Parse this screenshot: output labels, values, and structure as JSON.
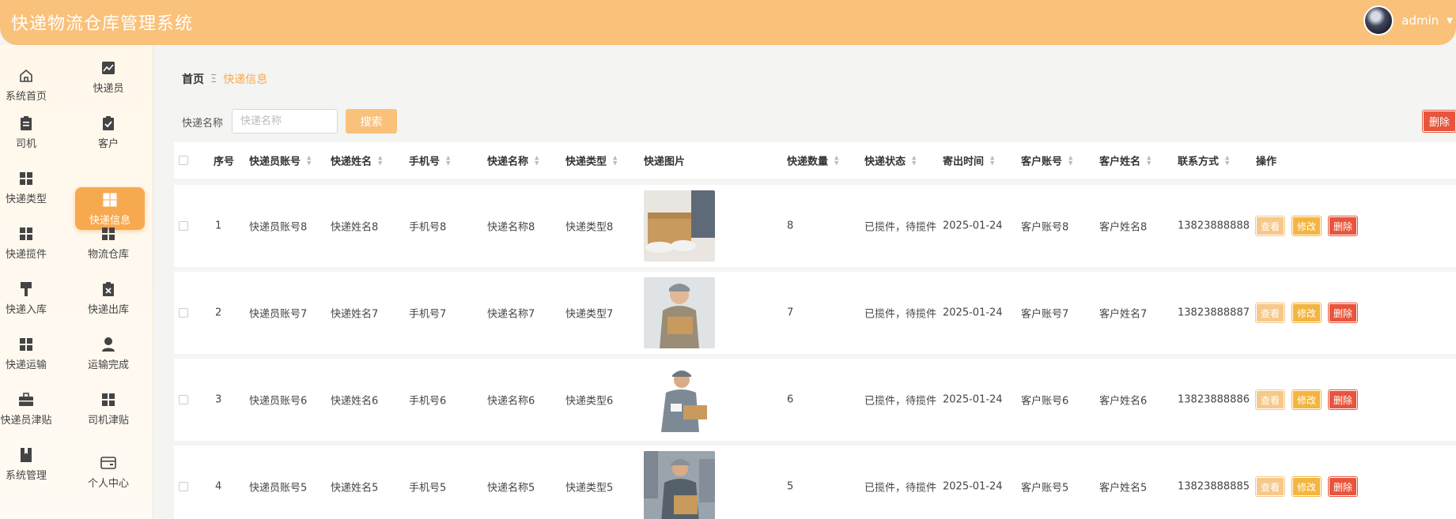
{
  "app": {
    "title": "快递物流仓库管理系统"
  },
  "user": {
    "name": "admin"
  },
  "sidebar": {
    "items": [
      {
        "label": "系统首页",
        "icon": "home-icon"
      },
      {
        "label": "快递员",
        "icon": "chart-icon"
      },
      {
        "label": "司机",
        "icon": "clipboard-icon"
      },
      {
        "label": "客户",
        "icon": "clipboard-check-icon"
      },
      {
        "label": "快递类型",
        "icon": "grid-icon"
      },
      {
        "label": "快递信息",
        "icon": "grid-icon",
        "active": true
      },
      {
        "label": "快递揽件",
        "icon": "grid-icon"
      },
      {
        "label": "物流仓库",
        "icon": "grid-icon"
      },
      {
        "label": "快递入库",
        "icon": "brush-icon"
      },
      {
        "label": "快递出库",
        "icon": "clipboard-x-icon"
      },
      {
        "label": "快递运输",
        "icon": "grid-icon"
      },
      {
        "label": "运输完成",
        "icon": "person-icon"
      },
      {
        "label": "快递员津贴",
        "icon": "briefcase-icon"
      },
      {
        "label": "司机津贴",
        "icon": "grid-icon"
      },
      {
        "label": "系统管理",
        "icon": "book-icon"
      },
      {
        "label": "个人中心",
        "icon": "wallet-icon"
      }
    ]
  },
  "breadcrumb": {
    "home": "首页",
    "separator": "Ξ",
    "current": "快递信息"
  },
  "search": {
    "label": "快递名称",
    "placeholder": "快递名称",
    "button": "搜索"
  },
  "toolbar": {
    "batch_delete": "删除"
  },
  "table": {
    "headers": [
      "序号",
      "快递员账号",
      "快递姓名",
      "手机号",
      "快递名称",
      "快递类型",
      "快递图片",
      "快递数量",
      "快递状态",
      "寄出时间",
      "客户账号",
      "客户姓名",
      "联系方式",
      "操作"
    ],
    "rows": [
      {
        "index": "1",
        "courier_account": "快递员账号8",
        "courier_name": "快递姓名8",
        "phone": "手机号8",
        "express_name": "快递名称8",
        "express_type": "快递类型8",
        "quantity": "8",
        "status": "已揽件，待揽件",
        "send_time": "2025-01-24",
        "customer_account": "客户账号8",
        "customer_name": "客户姓名8",
        "contact": "13823888888"
      },
      {
        "index": "2",
        "courier_account": "快递员账号7",
        "courier_name": "快递姓名7",
        "phone": "手机号7",
        "express_name": "快递名称7",
        "express_type": "快递类型7",
        "quantity": "7",
        "status": "已揽件，待揽件",
        "send_time": "2025-01-24",
        "customer_account": "客户账号7",
        "customer_name": "客户姓名7",
        "contact": "13823888887"
      },
      {
        "index": "3",
        "courier_account": "快递员账号6",
        "courier_name": "快递姓名6",
        "phone": "手机号6",
        "express_name": "快递名称6",
        "express_type": "快递类型6",
        "quantity": "6",
        "status": "已揽件，待揽件",
        "send_time": "2025-01-24",
        "customer_account": "客户账号6",
        "customer_name": "客户姓名6",
        "contact": "13823888886"
      },
      {
        "index": "4",
        "courier_account": "快递员账号5",
        "courier_name": "快递姓名5",
        "phone": "手机号5",
        "express_name": "快递名称5",
        "express_type": "快递类型5",
        "quantity": "5",
        "status": "已揽件，待揽件",
        "send_time": "2025-01-24",
        "customer_account": "客户账号5",
        "customer_name": "客户姓名5",
        "contact": "13823888885"
      }
    ],
    "actions": {
      "view": "查看",
      "edit": "修改",
      "delete": "删除"
    }
  },
  "colors": {
    "header": "#f9c17a",
    "accent": "#f7a94f",
    "danger": "#e8553d",
    "edit": "#f4b53f"
  }
}
